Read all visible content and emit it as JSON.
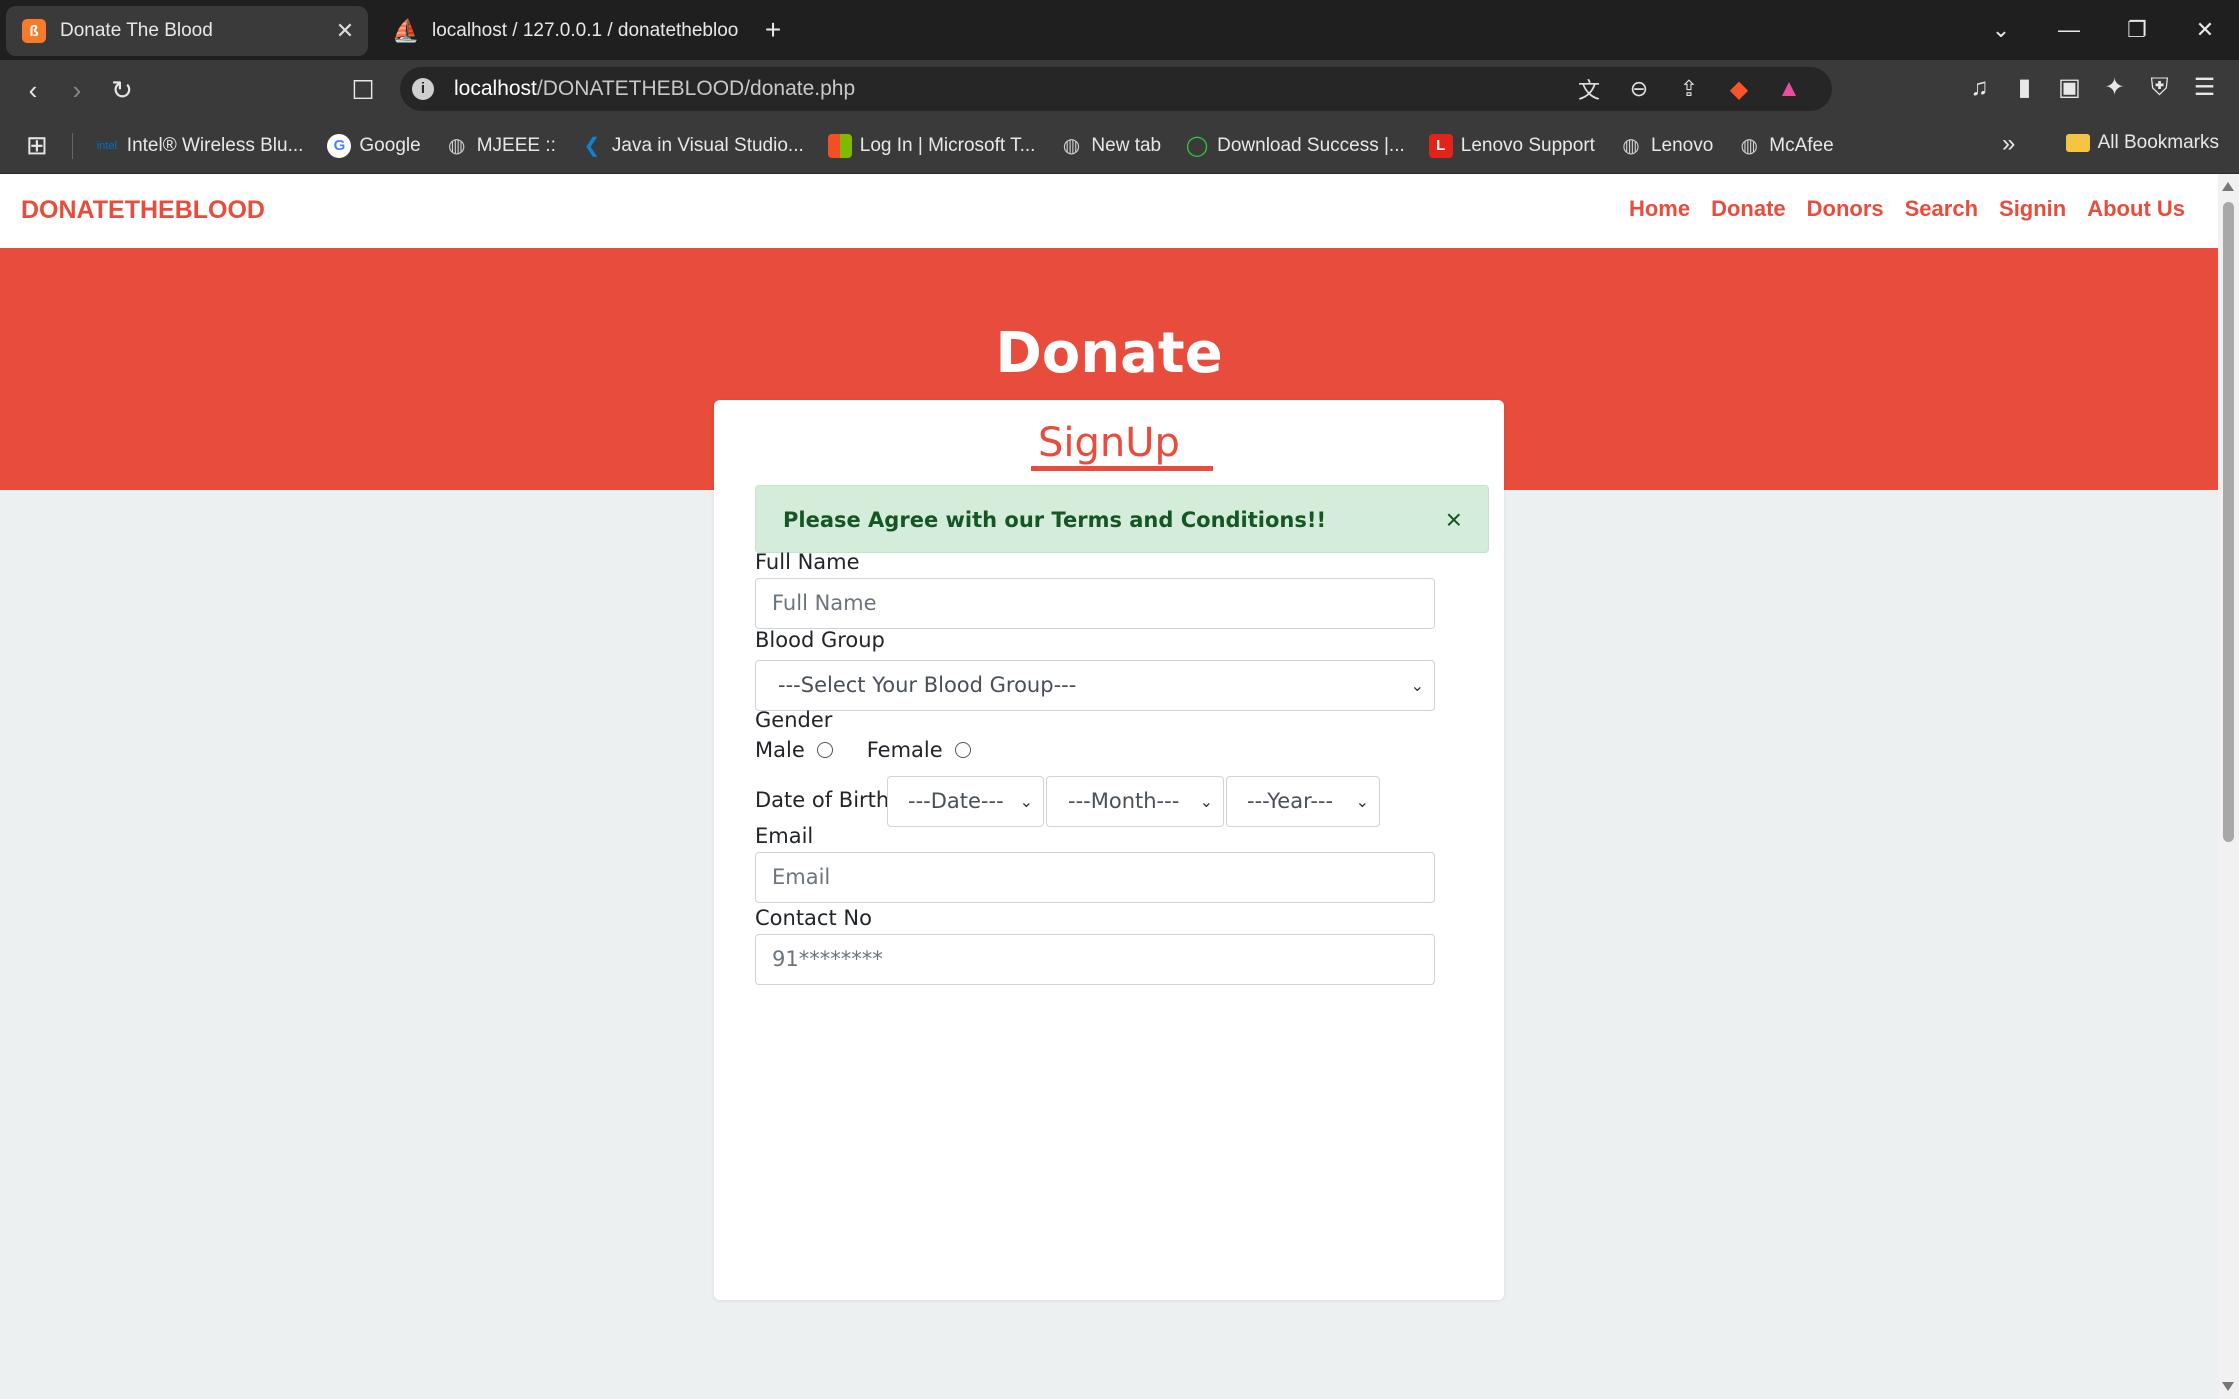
{
  "browser": {
    "tabs": [
      {
        "title": "Donate The Blood",
        "favicon": "xampp-icon",
        "active": true
      },
      {
        "title": "localhost / 127.0.0.1 / donatethebloo",
        "favicon": "phpmyadmin-icon",
        "active": false
      }
    ],
    "new_tab_glyph": "+",
    "address": {
      "host": "localhost",
      "path": "/DONATETHEBLOOD/donate.php"
    },
    "bookmarks": [
      {
        "label": "Intel® Wireless Blu...",
        "icon": "intel-icon",
        "color": "#0071c5"
      },
      {
        "label": "Google",
        "icon": "google-icon",
        "color": "#ffffff"
      },
      {
        "label": "MJEEE ::",
        "icon": "globe-icon",
        "color": "#cfcfcf"
      },
      {
        "label": "Java in Visual Studio...",
        "icon": "vscode-icon",
        "color": "#0a84d6"
      },
      {
        "label": "Log In | Microsoft T...",
        "icon": "microsoft-icon",
        "color": "#f25022"
      },
      {
        "label": "New tab",
        "icon": "globe-icon",
        "color": "#cfcfcf"
      },
      {
        "label": "Download Success |...",
        "icon": "download-icon",
        "color": "#2ecc40"
      },
      {
        "label": "Lenovo Support",
        "icon": "lenovo-icon",
        "color": "#e2231a"
      },
      {
        "label": "Lenovo",
        "icon": "globe-icon",
        "color": "#cfcfcf"
      },
      {
        "label": "McAfee",
        "icon": "globe-icon",
        "color": "#cfcfcf"
      }
    ],
    "all_bookmarks": "All Bookmarks"
  },
  "site": {
    "brand": "DONATETHEBLOOD",
    "nav": [
      "Home",
      "Donate",
      "Donors",
      "Search",
      "Signin",
      "About Us"
    ],
    "hero_title": "Donate",
    "accent_color": "#e74c3c"
  },
  "form": {
    "title": "SignUp",
    "alert": "Please Agree with our Terms and Conditions!!",
    "full_name_label": "Full Name",
    "full_name_placeholder": "Full Name",
    "blood_group_label": "Blood Group",
    "blood_group_value": "---Select Your Blood Group---",
    "gender_label": "Gender",
    "gender_options": [
      "Male",
      "Female"
    ],
    "dob_label": "Date of Birth:",
    "dob_date": "---Date---",
    "dob_month": "---Month---",
    "dob_year": "---Year---",
    "email_label": "Email",
    "email_placeholder": "Email",
    "contact_label": "Contact No",
    "contact_placeholder": "91********"
  }
}
